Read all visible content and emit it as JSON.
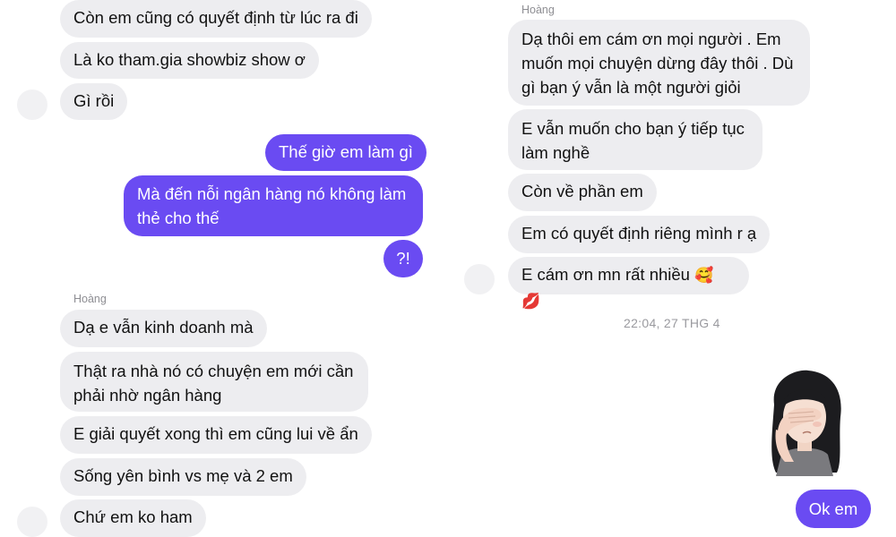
{
  "left_column": {
    "messages_top": [
      {
        "text": "Còn em cũng có quyết định từ lúc ra đi"
      },
      {
        "text": "Là ko tham.gia showbiz show ơ"
      },
      {
        "text": "Gì rồi"
      }
    ],
    "outgoing": [
      {
        "text": "Thế giờ em làm gì"
      },
      {
        "text": "Mà đến nỗi ngân hàng nó không làm thẻ cho thế"
      },
      {
        "text": "?!"
      }
    ],
    "sender_name": "Hoàng",
    "messages_bottom": [
      {
        "text": "Dạ e vẫn kinh doanh mà"
      },
      {
        "text": "Thật ra nhà nó có chuyện em mới cần phải nhờ ngân hàng"
      },
      {
        "text": "E giải quyết xong thì em cũng lui về ẩn"
      },
      {
        "text": "Sống yên bình vs mẹ và 2 em"
      },
      {
        "text": "Chứ em ko ham"
      }
    ]
  },
  "right_column": {
    "sender_name": "Hoàng",
    "messages": [
      {
        "text": "Dạ thôi em cám ơn mọi người . Em muốn mọi chuyện dừng đây thôi . Dù gì bạn ý vẫn là một người giỏi"
      },
      {
        "text": "E vẫn muốn cho bạn ý tiếp tục làm nghề"
      },
      {
        "text": "Còn về phần em"
      },
      {
        "text": "Em có quyết định riêng mình r ạ"
      },
      {
        "text": "E cám ơn mn rất nhiều",
        "emojis": "🥰 💋"
      }
    ],
    "timestamp": "22:04, 27 THG 4",
    "reply": {
      "text": "Ok em"
    },
    "sticker": "memoji-facepalm-sticker"
  },
  "colors": {
    "incoming_bubble": "#ededf0",
    "outgoing_bubble": "#6a4bf2",
    "outgoing_text": "#ffffff",
    "meta_text": "#8e8e93"
  }
}
